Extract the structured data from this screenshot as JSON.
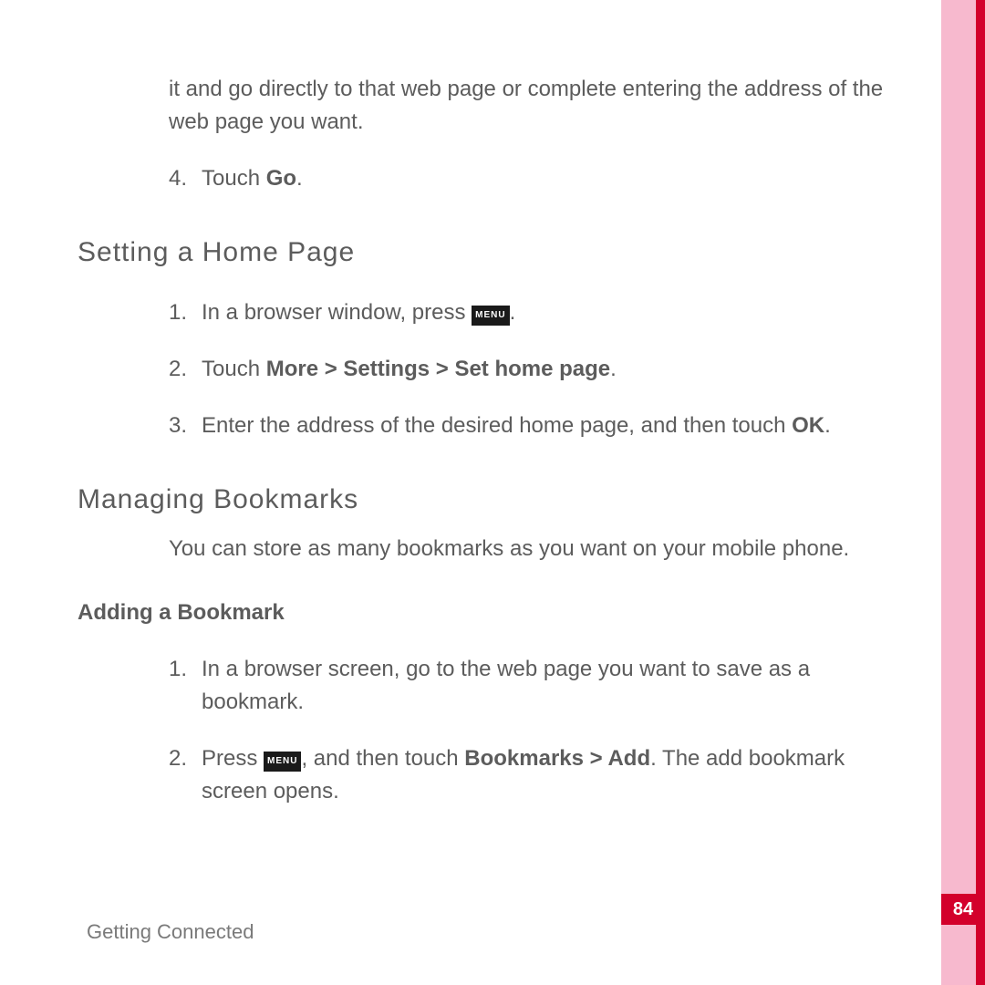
{
  "pageNumber": "84",
  "footer": "Getting Connected",
  "menuKeyLabel": "MENU",
  "continuation": {
    "p1": "it and go directly to that web page or complete entering the address of the web page you want.",
    "step4_num": "4.",
    "step4_prefix": "Touch ",
    "step4_bold": "Go",
    "step4_suffix": "."
  },
  "section1": {
    "title": "Setting  a  Home  Page",
    "step1_num": "1.",
    "step1_prefix": "In a browser window, press ",
    "step1_suffix": ".",
    "step2_num": "2.",
    "step2_prefix": "Touch ",
    "step2_bold": "More > Settings > Set home page",
    "step2_suffix": ".",
    "step3_num": "3.",
    "step3_prefix": "Enter the address of the desired home page, and then touch ",
    "step3_bold": "OK",
    "step3_suffix": "."
  },
  "section2": {
    "title": "Managing  Bookmarks",
    "intro": "You can store as many bookmarks as you want on your mobile phone.",
    "sub1": {
      "title": "Adding a Bookmark",
      "step1_num": "1.",
      "step1_text": "In a browser screen, go to the web page you want to save as a bookmark.",
      "step2_num": "2.",
      "step2_prefix": "Press ",
      "step2_mid": ", and then touch ",
      "step2_bold": "Bookmarks > Add",
      "step2_suffix": ". The add bookmark screen opens."
    }
  }
}
